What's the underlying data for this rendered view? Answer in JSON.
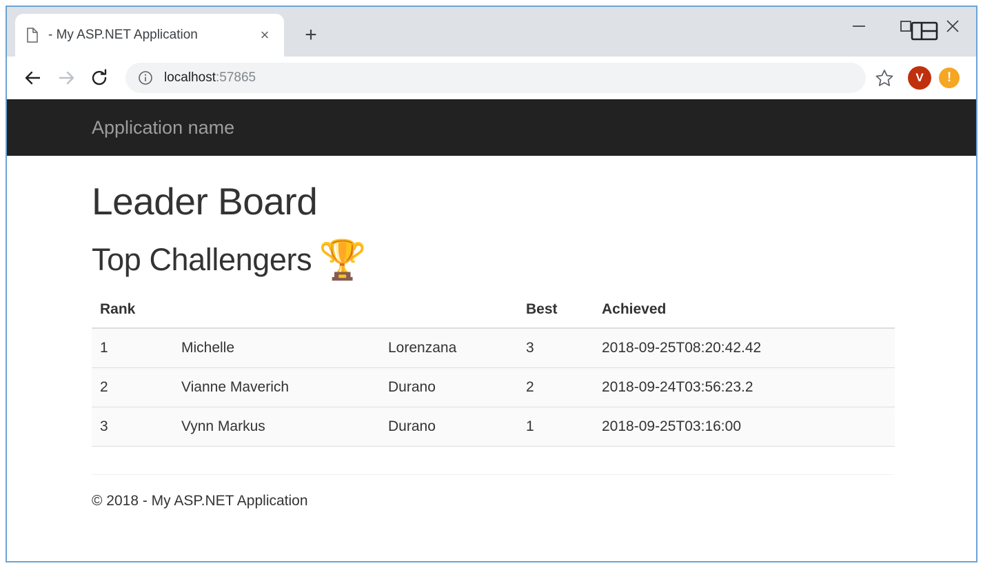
{
  "browser": {
    "tab": {
      "title": "- My ASP.NET Application",
      "favicon_icon": "page-icon",
      "close_icon": "×"
    },
    "new_tab_icon": "+",
    "panel_toggle_icon": "split-panel-icon",
    "window_controls": {
      "minimize_icon": "minimize-icon",
      "maximize_icon": "maximize-icon",
      "close_icon": "close-icon"
    },
    "toolbar": {
      "back_icon": "back-arrow-icon",
      "forward_icon": "forward-arrow-icon",
      "reload_icon": "reload-icon",
      "site_info_icon": "info-circle-icon",
      "url_host": "localhost",
      "url_port": ":57865",
      "url_full": "localhost:57865",
      "bookmark_icon": "star-icon",
      "avatar_initial": "V",
      "alert_badge_icon": "!"
    }
  },
  "page": {
    "navbar": {
      "brand": "Application name"
    },
    "title": "Leader Board",
    "section_title": "Top Challengers",
    "trophy_icon": "🏆",
    "table": {
      "headers": [
        "Rank",
        "",
        "",
        "Best",
        "Achieved",
        ""
      ],
      "rows": [
        {
          "rank": "1",
          "first_name": "Michelle",
          "last_name": "Lorenzana",
          "best": "3",
          "achieved": "2018-09-25T08:20:42.42",
          "extra": ""
        },
        {
          "rank": "2",
          "first_name": "Vianne Maverich",
          "last_name": "Durano",
          "best": "2",
          "achieved": "2018-09-24T03:56:23.2",
          "extra": ""
        },
        {
          "rank": "3",
          "first_name": "Vynn Markus",
          "last_name": "Durano",
          "best": "1",
          "achieved": "2018-09-25T03:16:00",
          "extra": ""
        }
      ]
    },
    "footer": {
      "copyright": "© 2018 - My ASP.NET Application"
    }
  },
  "colors": {
    "navbar_bg": "#222222",
    "navbar_text": "#9d9d9d",
    "tabstrip_bg": "#dee1e6",
    "window_border": "#6aa3d6",
    "avatar_bg": "#c0300e",
    "alert_bg": "#f5a623",
    "row_bg": "#fafafa",
    "row_border": "#dddddd"
  }
}
